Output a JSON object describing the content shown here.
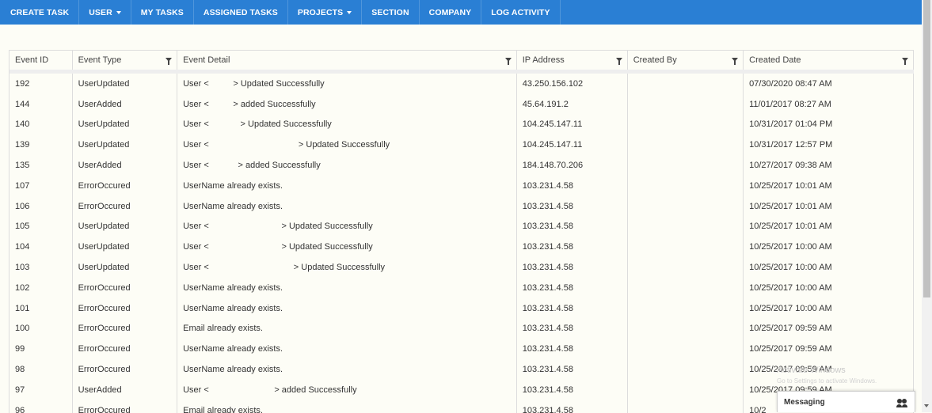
{
  "nav": {
    "items": [
      {
        "label": "CREATE TASK",
        "dropdown": false
      },
      {
        "label": "USER",
        "dropdown": true
      },
      {
        "label": "MY TASKS",
        "dropdown": false
      },
      {
        "label": "ASSIGNED TASKS",
        "dropdown": false
      },
      {
        "label": "PROJECTS",
        "dropdown": true
      },
      {
        "label": "SECTION",
        "dropdown": false
      },
      {
        "label": "COMPANY",
        "dropdown": false
      },
      {
        "label": "LOG ACTIVITY",
        "dropdown": false
      }
    ]
  },
  "grid": {
    "columns": [
      {
        "label": "Event ID",
        "filter": false
      },
      {
        "label": "Event Type",
        "filter": true
      },
      {
        "label": "Event Detail",
        "filter": true
      },
      {
        "label": "IP Address",
        "filter": true
      },
      {
        "label": "Created By",
        "filter": true
      },
      {
        "label": "Created Date",
        "filter": true
      }
    ],
    "rows": [
      {
        "id": "192",
        "type": "UserUpdated",
        "detail": "User <          > Updated Successfully",
        "ip": "43.250.156.102",
        "by": "",
        "date": "07/30/2020 08:47 AM"
      },
      {
        "id": "144",
        "type": "UserAdded",
        "detail": "User <          > added Successfully",
        "ip": "45.64.191.2",
        "by": "",
        "date": "11/01/2017 08:27 AM"
      },
      {
        "id": "140",
        "type": "UserUpdated",
        "detail": "User <             > Updated Successfully",
        "ip": "104.245.147.11",
        "by": "",
        "date": "10/31/2017 01:04 PM"
      },
      {
        "id": "139",
        "type": "UserUpdated",
        "detail": "User <                                     > Updated Successfully",
        "ip": "104.245.147.11",
        "by": "",
        "date": "10/31/2017 12:57 PM"
      },
      {
        "id": "135",
        "type": "UserAdded",
        "detail": "User <            > added Successfully",
        "ip": "184.148.70.206",
        "by": "",
        "date": "10/27/2017 09:38 AM"
      },
      {
        "id": "107",
        "type": "ErrorOccured",
        "detail": "UserName already exists.",
        "ip": "103.231.4.58",
        "by": "",
        "date": "10/25/2017 10:01 AM"
      },
      {
        "id": "106",
        "type": "ErrorOccured",
        "detail": "UserName already exists.",
        "ip": "103.231.4.58",
        "by": "",
        "date": "10/25/2017 10:01 AM"
      },
      {
        "id": "105",
        "type": "UserUpdated",
        "detail": "User <                              > Updated Successfully",
        "ip": "103.231.4.58",
        "by": "",
        "date": "10/25/2017 10:01 AM"
      },
      {
        "id": "104",
        "type": "UserUpdated",
        "detail": "User <                              > Updated Successfully",
        "ip": "103.231.4.58",
        "by": "",
        "date": "10/25/2017 10:00 AM"
      },
      {
        "id": "103",
        "type": "UserUpdated",
        "detail": "User <                                   > Updated Successfully",
        "ip": "103.231.4.58",
        "by": "",
        "date": "10/25/2017 10:00 AM"
      },
      {
        "id": "102",
        "type": "ErrorOccured",
        "detail": "UserName already exists.",
        "ip": "103.231.4.58",
        "by": "",
        "date": "10/25/2017 10:00 AM"
      },
      {
        "id": "101",
        "type": "ErrorOccured",
        "detail": "UserName already exists.",
        "ip": "103.231.4.58",
        "by": "",
        "date": "10/25/2017 10:00 AM"
      },
      {
        "id": "100",
        "type": "ErrorOccured",
        "detail": "Email already exists.",
        "ip": "103.231.4.58",
        "by": "",
        "date": "10/25/2017 09:59 AM"
      },
      {
        "id": "99",
        "type": "ErrorOccured",
        "detail": "UserName already exists.",
        "ip": "103.231.4.58",
        "by": "",
        "date": "10/25/2017 09:59 AM"
      },
      {
        "id": "98",
        "type": "ErrorOccured",
        "detail": "UserName already exists.",
        "ip": "103.231.4.58",
        "by": "",
        "date": "10/25/2017 09:59 AM"
      },
      {
        "id": "97",
        "type": "UserAdded",
        "detail": "User <                           > added Successfully",
        "ip": "103.231.4.58",
        "by": "",
        "date": "10/25/2017 09:59 AM"
      },
      {
        "id": "96",
        "type": "ErrorOccured",
        "detail": "Email already exists.",
        "ip": "103.231.4.58",
        "by": "",
        "date": "10/2"
      }
    ]
  },
  "watermark": {
    "title": "Activate Windows",
    "subtitle": "Go to Settings to activate Windows."
  },
  "messaging": {
    "label": "Messaging",
    "icon": "people-icon"
  },
  "colors": {
    "nav_bg": "#2a7fd4",
    "page_bg": "#fdfdf6"
  }
}
